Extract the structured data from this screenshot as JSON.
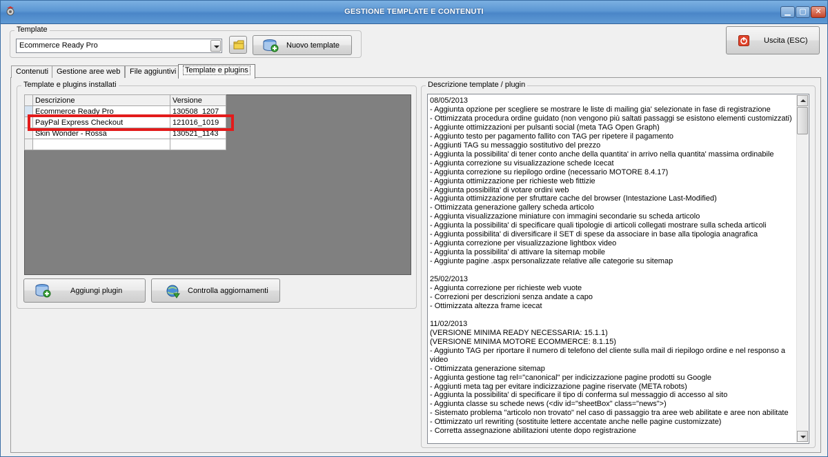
{
  "window": {
    "title": "GESTIONE TEMPLATE E CONTENUTI",
    "controls": {
      "minimize": "▁",
      "maximize": "▢",
      "close": "✕"
    }
  },
  "template_group": {
    "label": "Template",
    "selected": "Ecommerce Ready Pro",
    "new_template_label": "Nuovo template"
  },
  "exit_button": {
    "label": "Uscita (ESC)"
  },
  "tabs": [
    {
      "label": "Contenuti"
    },
    {
      "label": "Gestione aree web"
    },
    {
      "label": "File aggiuntivi"
    },
    {
      "label": "Template e plugins"
    }
  ],
  "installed": {
    "label": "Template e plugins installati",
    "columns": [
      "Descrizione",
      "Versione"
    ],
    "rows": [
      {
        "descrizione": "Ecommerce Ready Pro",
        "versione": "130508_1207"
      },
      {
        "descrizione": "PayPal Express Checkout",
        "versione": "121016_1019"
      },
      {
        "descrizione": "Skin Wonder - Rossa",
        "versione": "130521_1143"
      }
    ],
    "add_plugin_label": "Aggiungi plugin",
    "check_updates_label": "Controlla aggiornamenti"
  },
  "description": {
    "label": "Descrizione template / plugin",
    "text": "08/05/2013\n- Aggiunta opzione per scegliere se mostrare le liste di mailing gia' selezionate in fase di registrazione\n- Ottimizzata procedura ordine guidato (non vengono più saltati passaggi se esistono elementi customizzati)\n- Aggiunte ottimizzazioni per pulsanti social (meta TAG Open Graph)\n- Aggiunto testo per pagamento fallito con TAG per ripetere il pagamento\n- Aggiunti TAG su messaggio sostitutivo del prezzo\n- Aggiunta la possibilita' di tener conto anche della quantita' in arrivo nella quantita' massima ordinabile\n- Aggiunta correzione su visualizzazione schede Icecat\n- Aggiunta correzione su riepilogo ordine (necessario MOTORE 8.4.17)\n- Aggiunta ottimizzazione per richieste web fittizie\n- Aggiunta possibilita' di votare ordini web\n- Aggiunta ottimizzazione per sfruttare cache del browser (Intestazione Last-Modified)\n- Ottimizzata generazione gallery scheda articolo\n- Aggiunta visualizzazione miniature con immagini secondarie su scheda articolo\n- Aggiunta la possibilita' di specificare quali tipologie di articoli collegati mostrare sulla scheda articoli\n- Aggiunta possibilita' di diversificare il SET di spese da associare in base alla tipologia anagrafica\n- Aggiunta correzione per visualizzazione lightbox video\n- Aggiunta la possibilita' di attivare la sitemap mobile\n- Aggiunte pagine .aspx personalizzate relative alle categorie su sitemap\n\n25/02/2013\n- Aggiunta correzione per richieste web vuote\n- Correzioni per descrizioni senza andate a capo\n- Ottimizzata altezza frame icecat\n\n11/02/2013\n(VERSIONE MINIMA READY NECESSARIA: 15.1.1)\n(VERSIONE MINIMA MOTORE ECOMMERCE: 8.1.15)\n- Aggiunto TAG per riportare il numero di telefono del cliente sulla mail di riepilogo ordine e nel responso a video\n- Ottimizzata generazione sitemap\n- Aggiunta gestione tag rel=\"canonical\" per indicizzazione pagine prodotti su Google\n- Aggiunti meta tag per evitare indicizzazione pagine riservate (META robots)\n- Aggiunta la possibilita' di specificare il tipo di conferma sul messaggio di accesso al sito\n- Aggiunta classe su schede news (<div id=\"sheetBox\" class=\"news\">)\n- Sistemato problema \"articolo non trovato\" nel caso di passaggio tra aree web abilitate e aree non abilitate\n- Ottimizzato url rewriting (sostituite lettere accentate anche nelle pagine customizzate)\n- Corretta assegnazione abilitazioni utente dopo registrazione"
  },
  "colors": {
    "highlight": "#e31b1b",
    "title_bar": "#5c97d3"
  }
}
